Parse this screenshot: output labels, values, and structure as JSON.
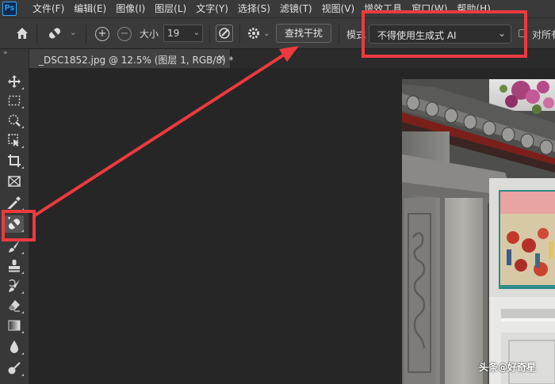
{
  "app": {
    "logo": "Ps"
  },
  "menu": [
    "文件(F)",
    "编辑(E)",
    "图像(I)",
    "图层(L)",
    "文字(Y)",
    "选择(S)",
    "滤镜(T)",
    "视图(V)",
    "增效工具",
    "窗口(W)",
    "帮助(H)"
  ],
  "options": {
    "home_icon": "home-icon",
    "tool_preset_icon": "remove-tool-icon",
    "size_label": "大小",
    "size_value": "19",
    "find_distractions_label": "查找干扰",
    "mode_label": "模式",
    "mode_value": "不得使用生成式 AI",
    "sample_all_label": "对所有"
  },
  "document": {
    "tab_title": "_DSC1852.jpg @ 12.5% (图层 1, RGB/8) *",
    "close_label": "×"
  },
  "toolbar": {
    "collapse_label": "»",
    "tools": [
      "move-icon",
      "marquee-icon",
      "quick-select-icon",
      "object-select-icon",
      "crop-icon",
      "frame-icon",
      "eyedropper-icon",
      "remove-tool-icon",
      "brush-icon",
      "stamp-icon",
      "history-brush-icon",
      "eraser-icon",
      "gradient-icon",
      "blur-icon",
      "dodge-icon"
    ]
  },
  "annotation": {
    "color": "#ec3a3f"
  },
  "watermark": "头条@好奇星"
}
